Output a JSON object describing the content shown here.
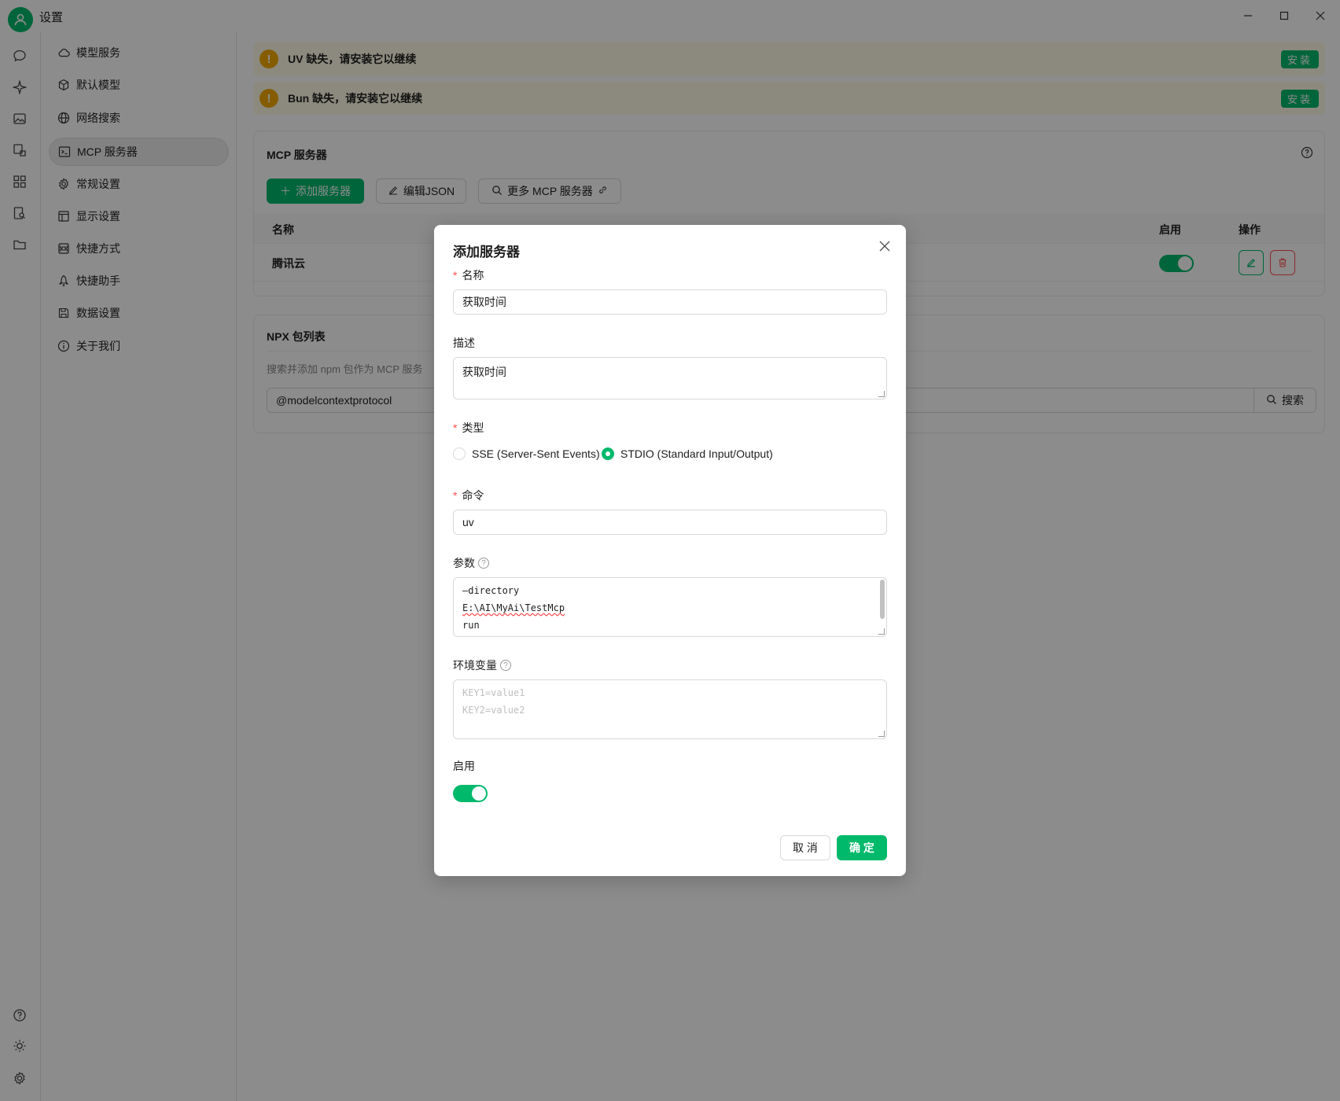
{
  "window": {
    "title": "设置"
  },
  "settings_nav": {
    "items": [
      {
        "label": "模型服务",
        "icon": "cloud-icon"
      },
      {
        "label": "默认模型",
        "icon": "cube-icon"
      },
      {
        "label": "网络搜索",
        "icon": "globe-icon"
      },
      {
        "label": "MCP 服务器",
        "icon": "terminal-icon",
        "active": true
      },
      {
        "label": "常规设置",
        "icon": "gear-icon"
      },
      {
        "label": "显示设置",
        "icon": "layout-icon"
      },
      {
        "label": "快捷方式",
        "icon": "command-icon"
      },
      {
        "label": "快捷助手",
        "icon": "rocket-icon"
      },
      {
        "label": "数据设置",
        "icon": "save-icon"
      },
      {
        "label": "关于我们",
        "icon": "info-icon"
      }
    ]
  },
  "alerts": [
    {
      "message": "UV 缺失，请安装它以继续",
      "action": "安装"
    },
    {
      "message": "Bun 缺失，请安装它以继续",
      "action": "安装"
    }
  ],
  "mcp_card": {
    "title": "MCP 服务器",
    "add_button": "添加服务器",
    "edit_json_button": "编辑JSON",
    "more_button": "更多 MCP 服务器",
    "columns": {
      "name": "名称",
      "enabled": "启用",
      "actions": "操作"
    },
    "rows": [
      {
        "name": "腾讯云",
        "enabled": true
      }
    ]
  },
  "npx_card": {
    "title": "NPX 包列表",
    "description": "搜索并添加 npm 包作为 MCP 服务",
    "search_value": "@modelcontextprotocol",
    "search_button": "搜索"
  },
  "modal": {
    "title": "添加服务器",
    "name_label": "名称",
    "name_value": "获取时间",
    "desc_label": "描述",
    "desc_value": "获取时间",
    "type_label": "类型",
    "type_options": [
      {
        "label": "SSE (Server-Sent Events)",
        "checked": false
      },
      {
        "label": "STDIO (Standard Input/Output)",
        "checked": true
      }
    ],
    "command_label": "命令",
    "command_value": "uv",
    "args_label": "参数",
    "args_lines": [
      "—directory",
      "E:\\AI\\MyAi\\TestMcp",
      "run"
    ],
    "env_label": "环境变量",
    "env_placeholder_lines": [
      "KEY1=value1",
      "KEY2=value2"
    ],
    "enabled_label": "启用",
    "enabled": true,
    "cancel_button": "取 消",
    "confirm_button": "确 定"
  },
  "colors": {
    "accent": "#00b96b",
    "warning": "#f2a900",
    "danger": "#ff4d4f",
    "alert_bg": "#fffbe6"
  }
}
